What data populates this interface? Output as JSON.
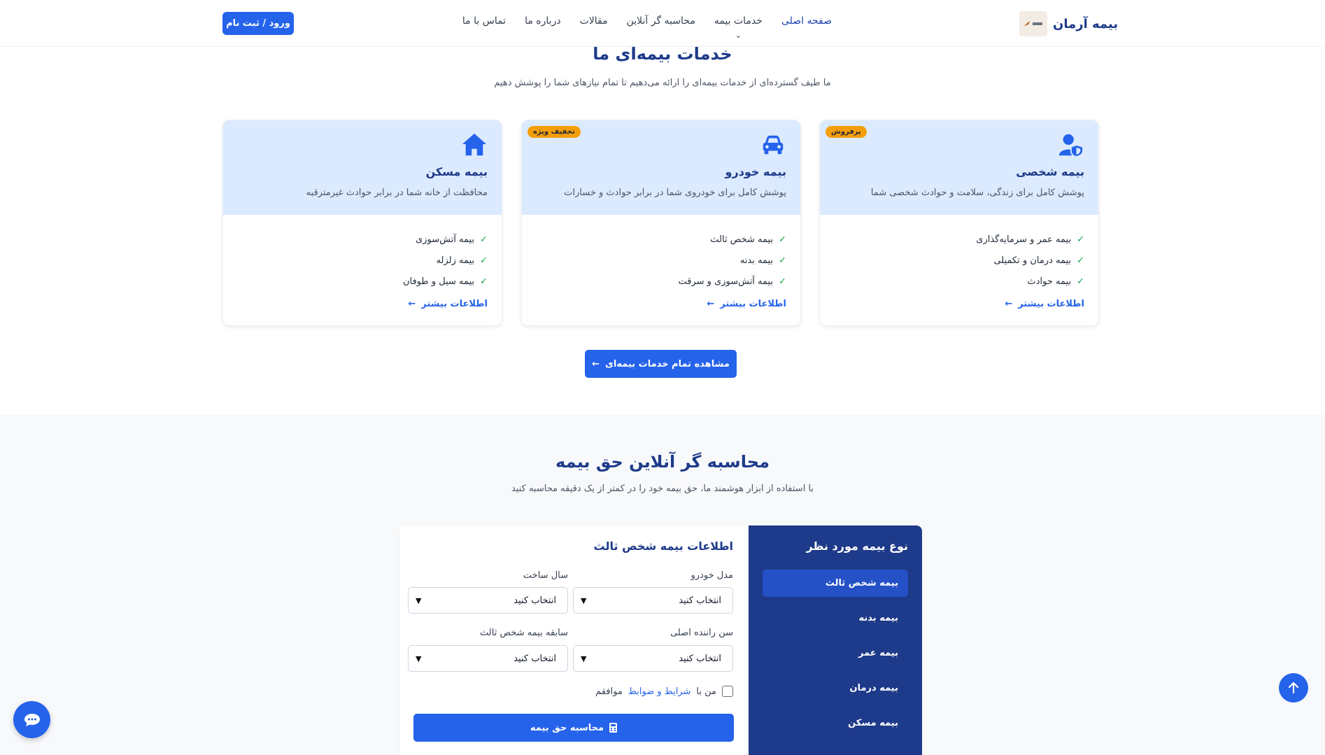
{
  "header": {
    "logo_text": "بیمه آرمان",
    "nav": [
      "صفحه اصلی",
      "خدمات بیمه",
      "محاسبه گر آنلاین",
      "مقالات",
      "درباره ما",
      "تماس با ما"
    ],
    "login_label": "ورود / ثبت نام"
  },
  "services": {
    "title": "خدمات بیمه‌ای ما",
    "subtitle": "ما طیف گسترده‌ای از خدمات بیمه‌ای را ارائه می‌دهیم تا تمام نیازهای شما را پوشش دهیم",
    "cards": [
      {
        "icon": "user-shield-icon",
        "badge": "پرفروش",
        "title": "بیمه شخصی",
        "desc": "پوشش کامل برای زندگی، سلامت و حوادث شخصی شما",
        "items": [
          "بیمه عمر و سرمایه‌گذاری",
          "بیمه درمان و تکمیلی",
          "بیمه حوادث"
        ],
        "more": "اطلاعات بیشتر"
      },
      {
        "icon": "car-icon",
        "badge": "تخفیف ویژه",
        "title": "بیمه خودرو",
        "desc": "پوشش کامل برای خودروی شما در برابر حوادث و خسارات",
        "items": [
          "بیمه شخص ثالث",
          "بیمه بدنه",
          "بیمه آتش‌سوزی و سرقت"
        ],
        "more": "اطلاعات بیشتر"
      },
      {
        "icon": "house-icon",
        "badge": "",
        "title": "بیمه مسکن",
        "desc": "محافظت از خانه شما در برابر حوادث غیرمترقبه",
        "items": [
          "بیمه آتش‌سوزی",
          "بیمه زلزله",
          "بیمه سیل و طوفان"
        ],
        "more": "اطلاعات بیشتر"
      }
    ],
    "all_button": "مشاهده تمام خدمات بیمه‌ای"
  },
  "calculator": {
    "title": "محاسبه گر آنلاین حق بیمه",
    "subtitle": "با استفاده از ابزار هوشمند ما، حق بیمه خود را در کمتر از یک دقیقه محاسبه کنید",
    "side_title": "نوع بیمه مورد نظر",
    "side_items": [
      "بیمه شخص ثالث",
      "بیمه بدنه",
      "بیمه عمر",
      "بیمه درمان",
      "بیمه مسکن"
    ],
    "form_title": "اطلاعات بیمه شخص ثالث",
    "fields": [
      {
        "label": "مدل خودرو",
        "value": "انتخاب کنید"
      },
      {
        "label": "سال ساخت",
        "value": "انتخاب کنید"
      },
      {
        "label": "سن راننده اصلی",
        "value": "انتخاب کنید"
      },
      {
        "label": "سابقه بیمه شخص ثالث",
        "value": "انتخاب کنید"
      }
    ],
    "agree_prefix": "من با",
    "agree_link": "شرایط و ضوابط",
    "agree_suffix": "موافقم",
    "submit": "محاسبه حق بیمه"
  },
  "colors": {
    "primary": "#2563eb",
    "navy": "#1e3a8a",
    "card_top": "#dbeafe",
    "badge": "#f59e0b"
  }
}
